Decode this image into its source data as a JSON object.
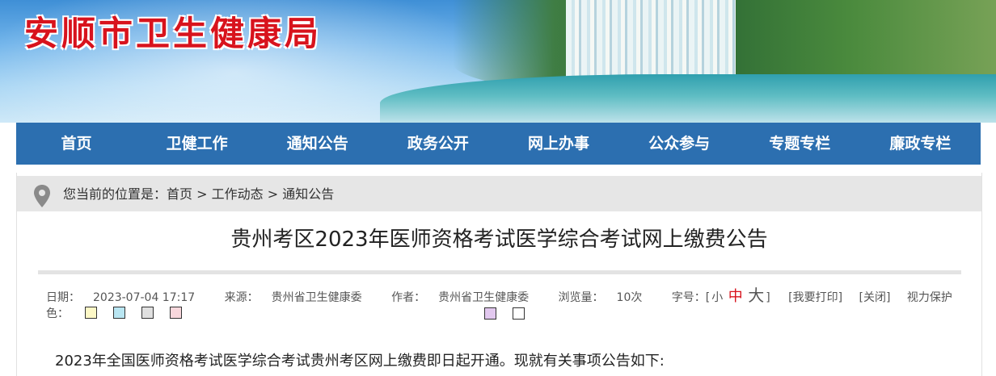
{
  "site": {
    "title": "安顺市卫生健康局"
  },
  "nav": {
    "items": [
      "首页",
      "卫健工作",
      "通知公告",
      "政务公开",
      "网上办事",
      "公众参与",
      "专题专栏",
      "廉政专栏"
    ]
  },
  "breadcrumb": {
    "prefix": "您当前的位置是：",
    "items": [
      "首页",
      "工作动态",
      "通知公告"
    ],
    "separator": " > "
  },
  "article": {
    "title": "贵州考区2023年医师资格考试医学综合考试网上缴费公告",
    "meta": {
      "date_label": "日期：",
      "date": "2023-07-04 17:17",
      "source_label": "来源：",
      "source": "贵州省卫生健康委",
      "author_label": "作者：",
      "author": "贵州省卫生健康委",
      "views_label": "浏览量：",
      "views": "10次",
      "font_label": "字号：[",
      "font_small": "小",
      "font_medium": "中",
      "font_large": "大",
      "font_close": "]",
      "print": "[我要打印]",
      "close": "[关闭]",
      "eye_label": "视力保护色：",
      "eye_colors": [
        "#fdf8c6",
        "#b9e6f2",
        "#e0e0e0",
        "#f8d7dc",
        "#e2c8ef",
        "#ffffff"
      ]
    },
    "body": "2023年全国医师资格考试医学综合考试贵州考区网上缴费即日起开通。现就有关事项公告如下:"
  },
  "colors": {
    "nav_bg": "#2c6fb0",
    "title_red": "#d8131d",
    "crumb_bg": "#e6e6e6"
  }
}
